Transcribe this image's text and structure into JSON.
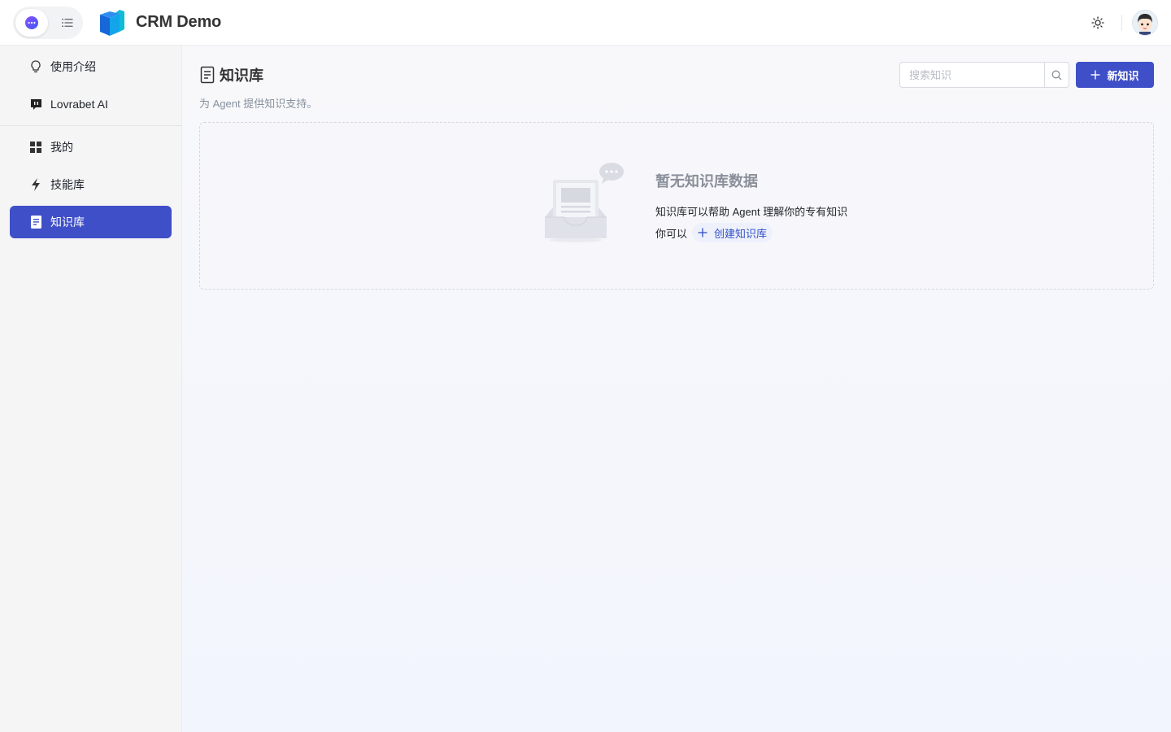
{
  "header": {
    "app_title": "CRM Demo",
    "modes": [
      {
        "name": "chat",
        "icon": "chat-bubble-icon",
        "active": true
      },
      {
        "name": "list",
        "icon": "list-icon",
        "active": false
      }
    ],
    "theme_icon": "sun-icon"
  },
  "sidebar": {
    "items": [
      {
        "label": "使用介绍",
        "icon": "lightbulb-icon",
        "active": false
      },
      {
        "label": "Lovrabet AI",
        "icon": "chat-square-icon",
        "active": false
      },
      {
        "label": "我的",
        "icon": "grid-icon",
        "active": false
      },
      {
        "label": "技能库",
        "icon": "lightning-icon",
        "active": false
      },
      {
        "label": "知识库",
        "icon": "document-icon",
        "active": true
      }
    ]
  },
  "main": {
    "title": "知识库",
    "subtitle": "为 Agent 提供知识支持。",
    "search": {
      "placeholder": "搜索知识",
      "value": ""
    },
    "new_button_label": "新知识",
    "empty": {
      "title": "暂无知识库数据",
      "description": "知识库可以帮助 Agent 理解你的专有知识",
      "prompt": "你可以",
      "create_link_label": "创建知识库"
    }
  },
  "colors": {
    "accent": "#3f4fc7",
    "link": "#3150c8",
    "sidebar_bg": "#f5f5f6"
  }
}
